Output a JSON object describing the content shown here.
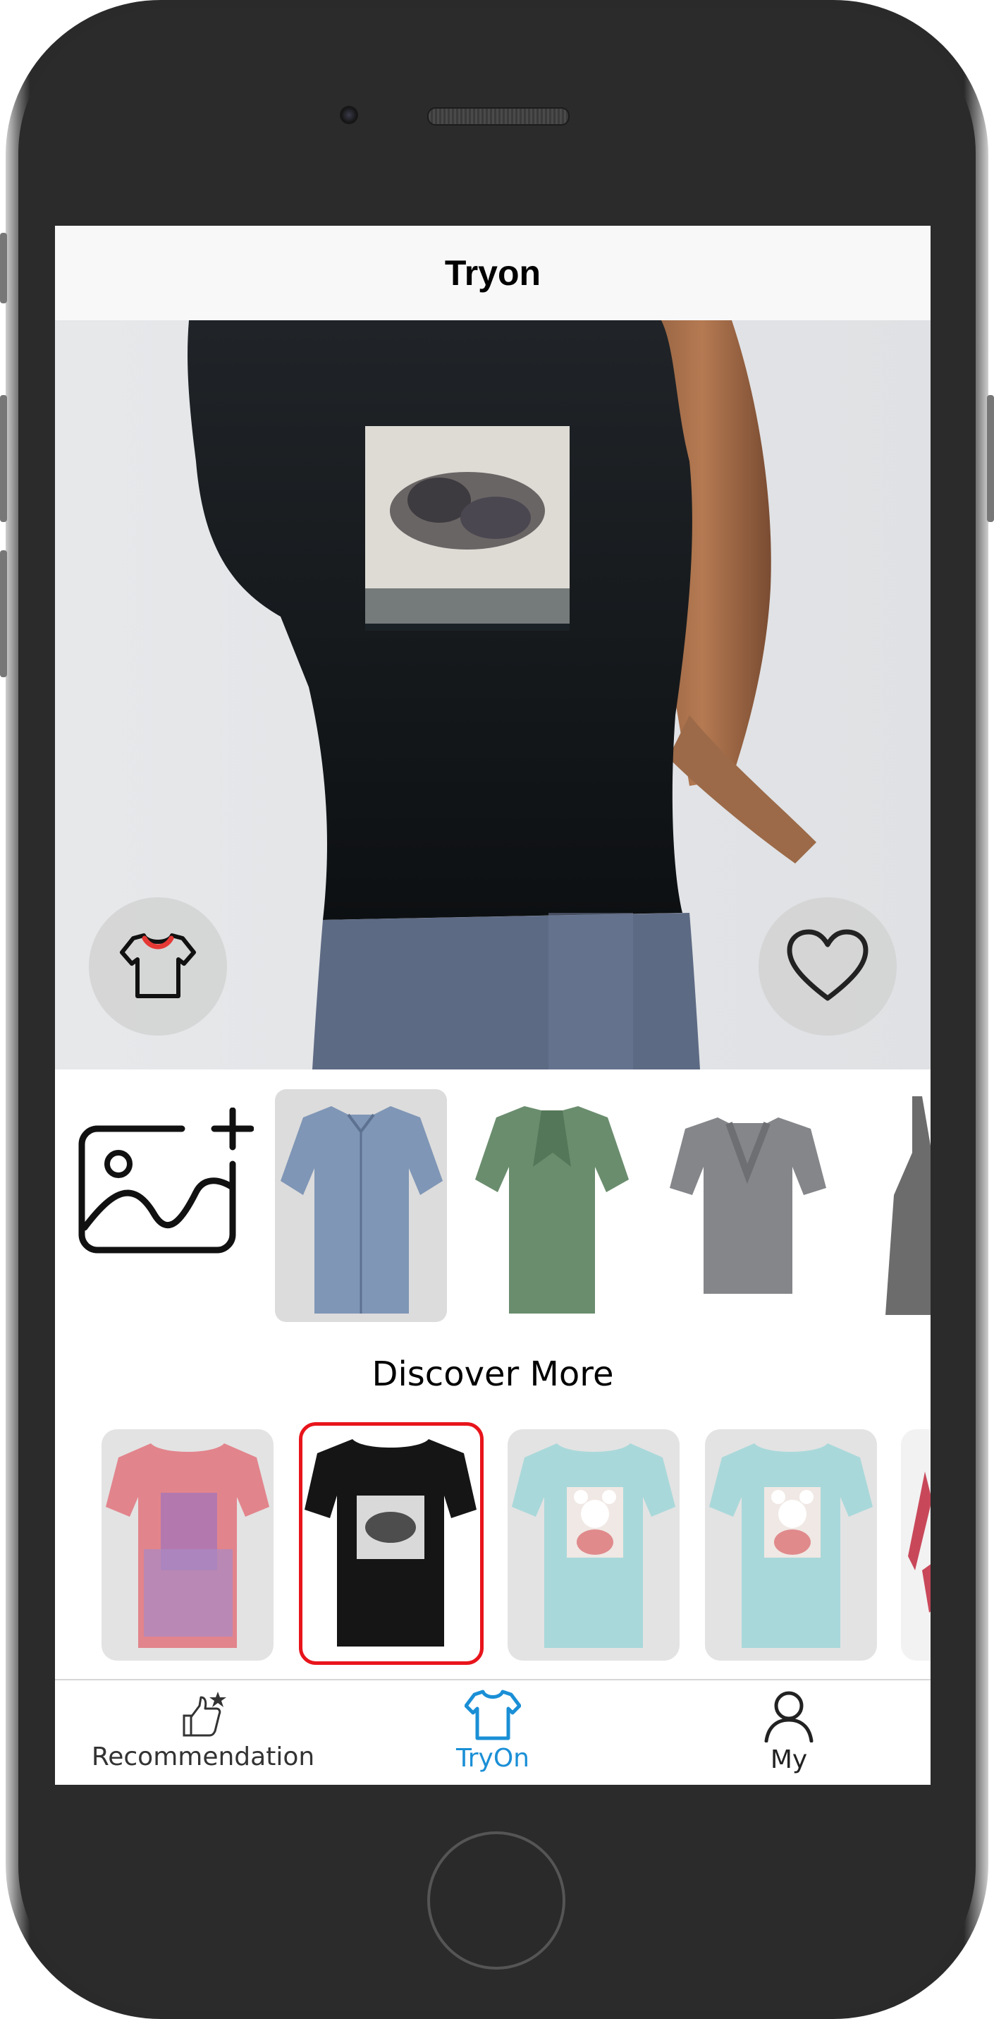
{
  "header": {
    "title": "Tryon"
  },
  "tryon": {
    "outfit_button_icon": "tshirt-icon",
    "favorite_button_icon": "heart-icon"
  },
  "wardrobe": {
    "add_photo_icon": "add-photo-icon",
    "items": [
      {
        "name": "blue-short-sleeve-shirt",
        "color": "#7f96b6",
        "selected": true
      },
      {
        "name": "green-short-sleeve-shirt",
        "color": "#6a8d6e",
        "selected": false
      },
      {
        "name": "gray-ruffle-tee",
        "color": "#85868a",
        "selected": false
      },
      {
        "name": "gray-tank-dress",
        "color": "#6c6c6c",
        "selected": false
      }
    ]
  },
  "discover": {
    "title": "Discover More",
    "items": [
      {
        "name": "pink-graphic-tee",
        "color": "#e2848c",
        "selected": false
      },
      {
        "name": "black-graphic-tee",
        "color": "#151515",
        "selected": true
      },
      {
        "name": "mint-mickey-tee",
        "color": "#a9d8da",
        "selected": false
      },
      {
        "name": "mint-mickey-tee-2",
        "color": "#a9d8da",
        "selected": false
      },
      {
        "name": "red-item",
        "color": "#c8485a",
        "selected": false
      }
    ]
  },
  "tabs": [
    {
      "label": "Recommendation",
      "icon": "thumbs-up-icon",
      "active": false
    },
    {
      "label": "TryOn",
      "icon": "tshirt-icon",
      "active": true
    },
    {
      "label": "My",
      "icon": "user-icon",
      "active": false
    }
  ],
  "colors": {
    "accent": "#1a8fd6",
    "selection": "#e8141b",
    "tab_inactive": "#333333"
  }
}
